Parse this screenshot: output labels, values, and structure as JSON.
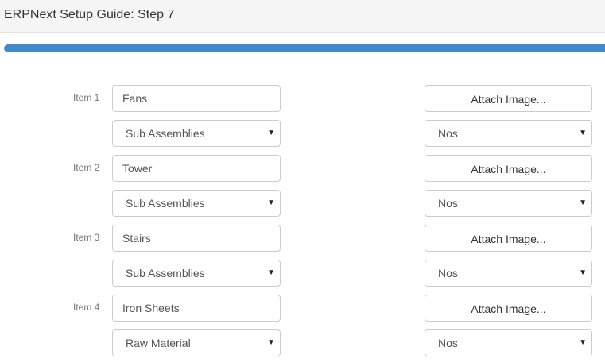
{
  "header": {
    "title": "ERPNext Setup Guide: Step 7"
  },
  "progress": {
    "value": 1.0,
    "color": "#428bca"
  },
  "items": [
    {
      "label": "Item 1",
      "name": "Fans",
      "group": "Sub Assemblies",
      "uom": "Nos",
      "attach_label": "Attach Image..."
    },
    {
      "label": "Item 2",
      "name": "Tower",
      "group": "Sub Assemblies",
      "uom": "Nos",
      "attach_label": "Attach Image..."
    },
    {
      "label": "Item 3",
      "name": "Stairs",
      "group": "Sub Assemblies",
      "uom": "Nos",
      "attach_label": "Attach Image..."
    },
    {
      "label": "Item 4",
      "name": "Iron Sheets",
      "group": "Raw Material",
      "uom": "Nos",
      "attach_label": "Attach Image..."
    }
  ],
  "icons": {
    "dropdown": "caret-down-icon"
  }
}
